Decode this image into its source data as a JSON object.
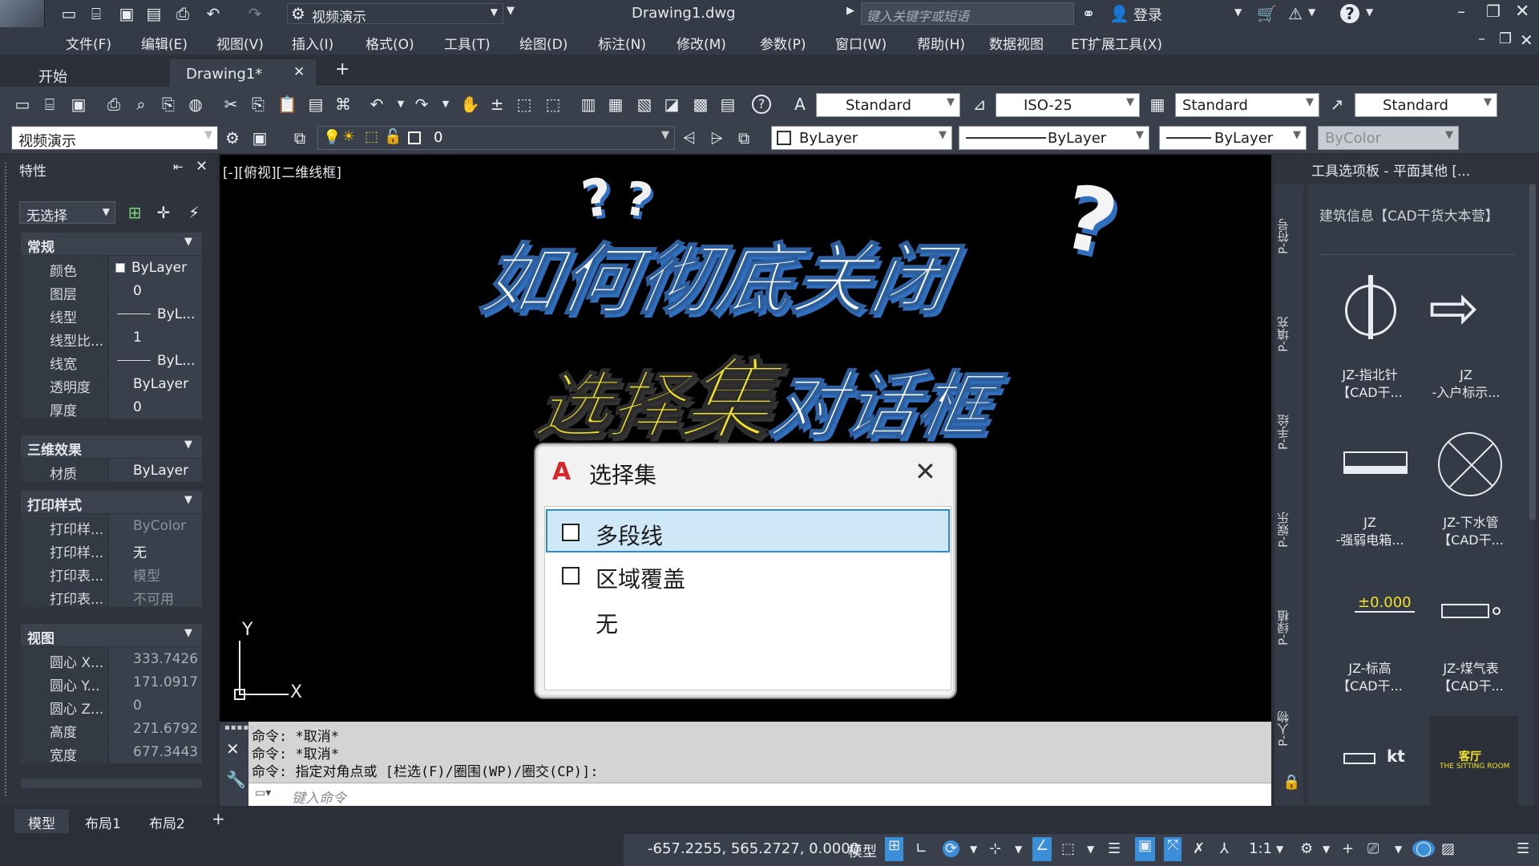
{
  "titlebar": {
    "workspace": "视频演示",
    "filename": "Drawing1.dwg",
    "search_placeholder": "键入关键字或短语",
    "login": "登录"
  },
  "menu": [
    "文件(F)",
    "编辑(E)",
    "视图(V)",
    "插入(I)",
    "格式(O)",
    "工具(T)",
    "绘图(D)",
    "标注(N)",
    "修改(M)",
    "参数(P)",
    "窗口(W)",
    "帮助(H)",
    "数据视图",
    "ET扩展工具(X)"
  ],
  "tabs": {
    "start": "开始",
    "drawing": "Drawing1*",
    "add": "+"
  },
  "styles": {
    "text": "Standard",
    "dim": "ISO-25",
    "table": "Standard",
    "mleader": "Standard"
  },
  "layer": {
    "workspace": "视频演示",
    "current": "0",
    "color": "ByLayer",
    "linetype": "ByLayer",
    "lineweight": "ByLayer",
    "plotstyle": "ByColor"
  },
  "properties": {
    "title": "特性",
    "selection": "无选择",
    "general": {
      "title": "常规",
      "rows": [
        [
          "颜色",
          "ByLayer"
        ],
        [
          "图层",
          "0"
        ],
        [
          "线型",
          "ByL..."
        ],
        [
          "线型比...",
          "1"
        ],
        [
          "线宽",
          "ByL..."
        ],
        [
          "透明度",
          "ByLayer"
        ],
        [
          "厚度",
          "0"
        ]
      ]
    },
    "effects3d": {
      "title": "三维效果",
      "rows": [
        [
          "材质",
          "ByLayer"
        ]
      ]
    },
    "plot": {
      "title": "打印样式",
      "rows": [
        [
          "打印样...",
          "ByColor"
        ],
        [
          "打印样...",
          "无"
        ],
        [
          "打印表...",
          "模型"
        ],
        [
          "打印表...",
          "不可用"
        ]
      ]
    },
    "view": {
      "title": "视图",
      "rows": [
        [
          "圆心 X...",
          "333.7426"
        ],
        [
          "圆心 Y...",
          "171.0917"
        ],
        [
          "圆心 Z...",
          "0"
        ],
        [
          "高度",
          "271.6792"
        ],
        [
          "宽度",
          "677.3443"
        ]
      ]
    }
  },
  "viewport": {
    "label": "[-][俯视][二维线框]",
    "ucs_x": "X",
    "ucs_y": "Y"
  },
  "overlay": {
    "line1": "如何彻底关闭",
    "line2a": "选择",
    "line2b": "集",
    "line2c": "对话框",
    "q": "?"
  },
  "dialog": {
    "title": "选择集",
    "items": [
      {
        "label": "多段线",
        "checkbox": true,
        "selected": true
      },
      {
        "label": "区域覆盖",
        "checkbox": true,
        "selected": false
      },
      {
        "label": "无",
        "checkbox": false,
        "selected": false
      }
    ]
  },
  "command": {
    "history": [
      "命令: *取消*",
      "命令: *取消*",
      "命令: 指定对角点或 [栏选(F)/圈围(WP)/圈交(CP)]:"
    ],
    "placeholder": "键入命令"
  },
  "palette": {
    "title": "工具选项板 - 平面其他 [...",
    "header": "建筑信息【CAD干货大本营】",
    "vtabs": [
      "P-符号",
      "P-填充",
      "P-手绘",
      "P-娱乐",
      "P-绿植",
      "P-人物"
    ],
    "tools": [
      {
        "l1": "JZ-指北针",
        "l2": "【CAD干..."
      },
      {
        "l1": "JZ",
        "l2": "-入户标示..."
      },
      {
        "l1": "JZ",
        "l2": "-强弱电箱..."
      },
      {
        "l1": "JZ-下水管",
        "l2": "【CAD干..."
      },
      {
        "l1": "JZ-标高",
        "l2": "【CAD干..."
      },
      {
        "l1": "JZ-煤气表",
        "l2": "【CAD干..."
      }
    ],
    "elev": "±0.000",
    "kt": "kt",
    "room1": "客厅",
    "room2": "THE SITTING ROOM"
  },
  "layouts": [
    "模型",
    "布局1",
    "布局2"
  ],
  "status": {
    "coords": "-657.2255, 565.2727, 0.0000",
    "model": "模型",
    "scale": "1:1"
  }
}
